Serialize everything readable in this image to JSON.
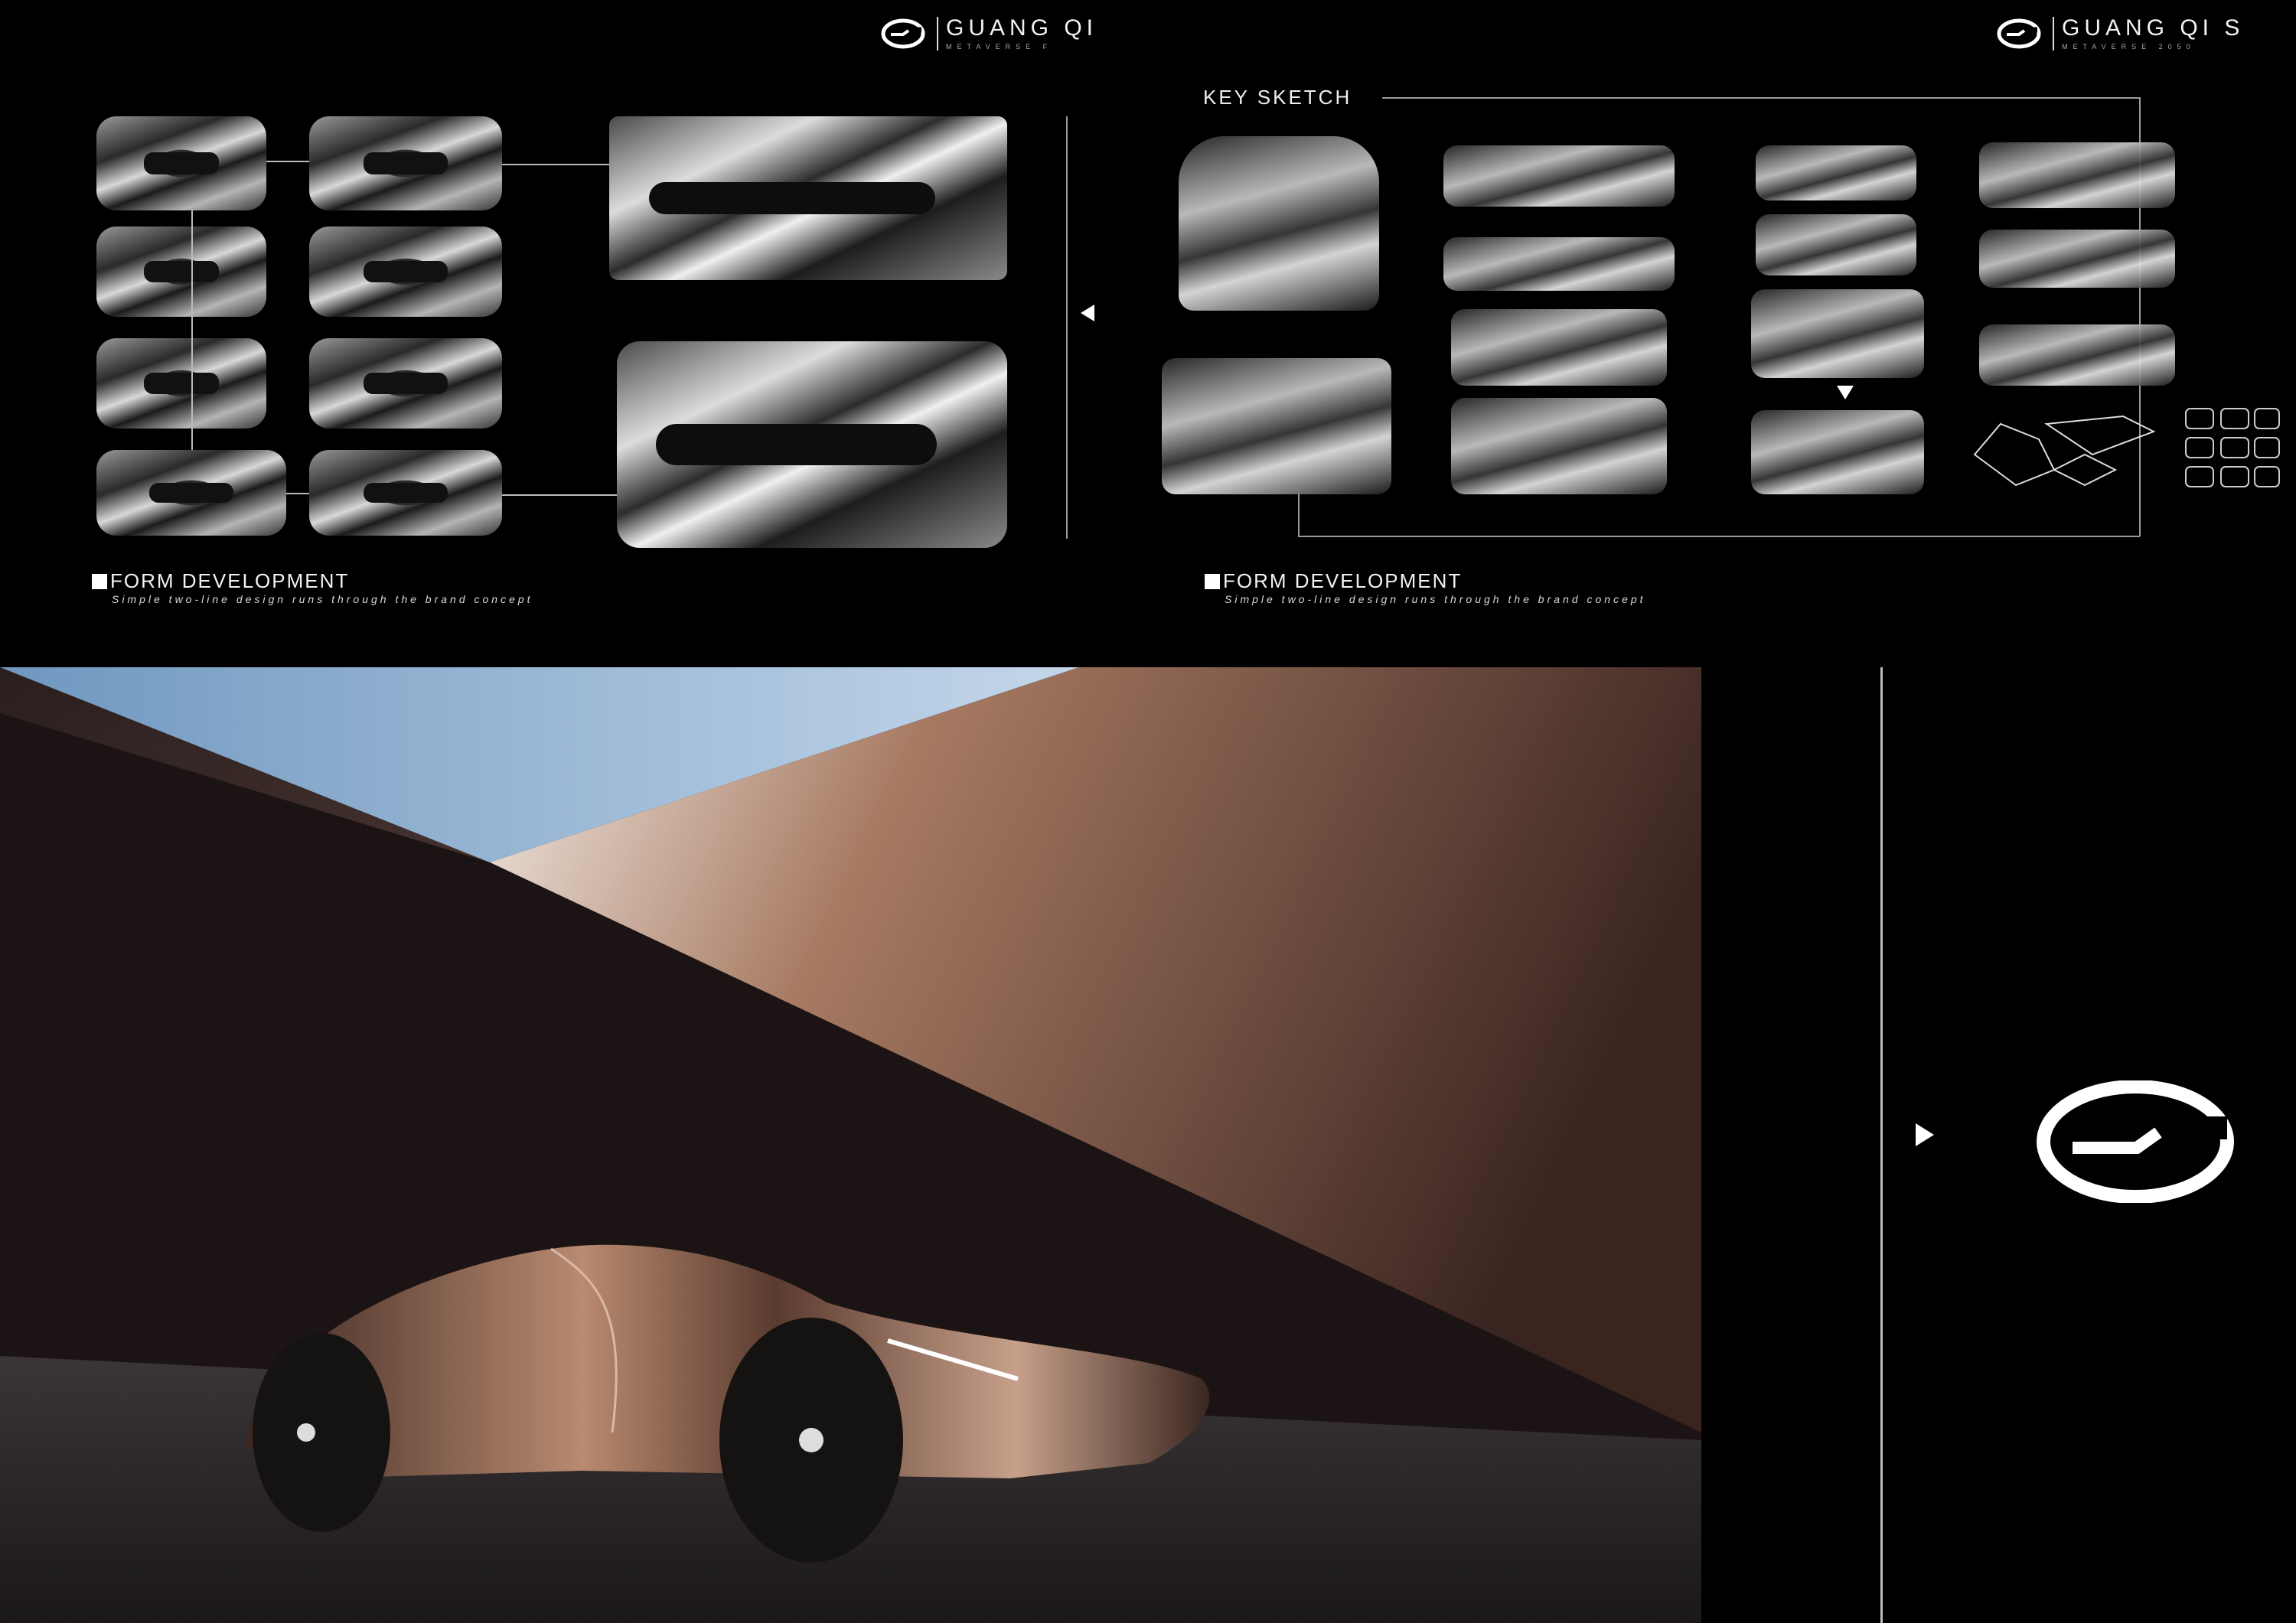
{
  "top_left_panel": {
    "brand": {
      "logo_icon": "gac-g-logo",
      "name": "GUANG QI",
      "subtitle": "METAVERSE F"
    },
    "caption": {
      "title": "FORM DEVELOPMENT",
      "subtitle": "Simple two-line design runs through the brand concept"
    }
  },
  "top_right_panel": {
    "brand": {
      "logo_icon": "gac-g-logo",
      "name": "GUANG QI   S",
      "subtitle": "METAVERSE 2050"
    },
    "section_label": "KEY SKETCH",
    "caption": {
      "title": "FORM DEVELOPMENT",
      "subtitle": "Simple two-line design runs through the brand concept"
    }
  },
  "bottom_right_panel": {
    "logo_icon": "gac-g-logo-large",
    "arrow_icon": "play-right-icon"
  },
  "icons": {
    "left_arrow": "triangle-left-icon",
    "down_arrow": "triangle-down-icon"
  },
  "colors": {
    "background": "#000000",
    "text": "#ffffff",
    "accent_bronze": "#8a6a5a",
    "sky": "#9ec0e0"
  }
}
